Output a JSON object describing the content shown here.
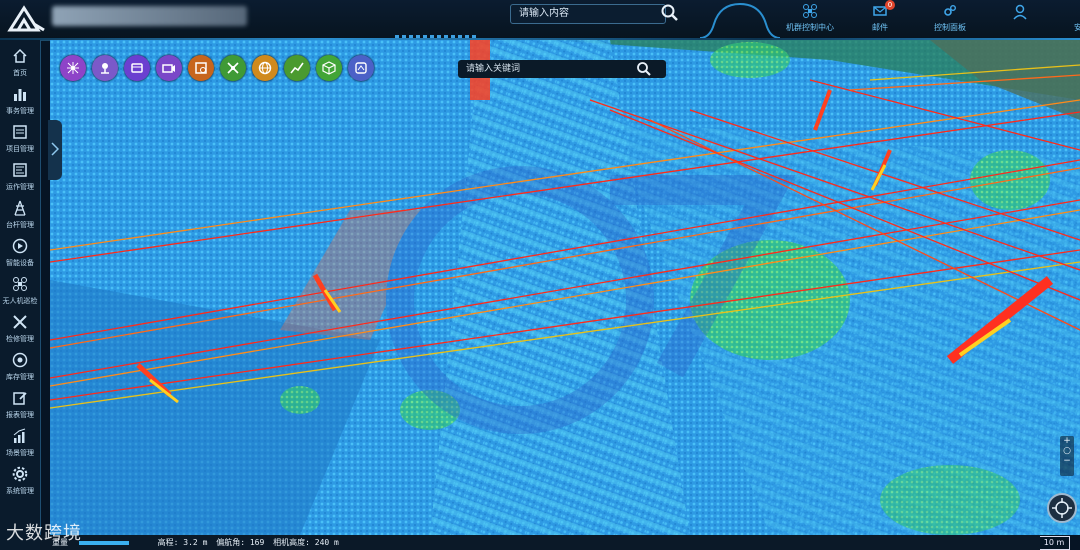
{
  "header": {
    "search_placeholder": "请输入内容",
    "nav": [
      {
        "label": "机群控制中心",
        "icon": "drone-icon"
      },
      {
        "label": "邮件",
        "icon": "mail-icon",
        "badge": "0"
      },
      {
        "label": "控制面板",
        "icon": "gears-icon"
      },
      {
        "label": "",
        "icon": "user-icon"
      },
      {
        "label": "安全退出",
        "icon": "power-icon"
      }
    ]
  },
  "sidebar": {
    "items": [
      {
        "label": "首页",
        "icon": "home-icon"
      },
      {
        "label": "事务管理",
        "icon": "bar-chart-icon"
      },
      {
        "label": "项目管理",
        "icon": "document-icon"
      },
      {
        "label": "运作管理",
        "icon": "form-icon"
      },
      {
        "label": "台杆管理",
        "icon": "tower-icon"
      },
      {
        "label": "智能设备",
        "icon": "play-icon"
      },
      {
        "label": "无人机巡检",
        "icon": "drone-icon"
      },
      {
        "label": "检修管理",
        "icon": "tools-icon"
      },
      {
        "label": "库存管理",
        "icon": "target-icon"
      },
      {
        "label": "报表管理",
        "icon": "edit-icon"
      },
      {
        "label": "场景管理",
        "icon": "stats-icon"
      },
      {
        "label": "系统管理",
        "icon": "settings-icon"
      }
    ]
  },
  "map": {
    "search_placeholder": "请输入关键词",
    "tools": [
      {
        "icon": "network-icon",
        "color": "#8e44c8"
      },
      {
        "icon": "pin-icon",
        "color": "#7b59c9"
      },
      {
        "icon": "layers-icon",
        "color": "#6b3fd0"
      },
      {
        "icon": "camera-icon",
        "color": "#7a47c8"
      },
      {
        "icon": "analysis-icon",
        "color": "#c7651d"
      },
      {
        "icon": "route-icon",
        "color": "#3f9a36"
      },
      {
        "icon": "globe-icon",
        "color": "#d08a1d"
      },
      {
        "icon": "line-chart-icon",
        "color": "#4a9a2f"
      },
      {
        "icon": "cube-icon",
        "color": "#42a537"
      },
      {
        "icon": "map-icon",
        "color": "#4b61c7"
      }
    ],
    "scale": "10 m",
    "zoom_in": "+",
    "zoom_reset": "○",
    "zoom_out": "−"
  },
  "status": {
    "level_label": "重量",
    "height_label": "高程",
    "height_value": "3.2 m",
    "heading_label": "偏航角",
    "heading_value": "169",
    "camera_label": "相机高度",
    "camera_value": "240 m"
  },
  "watermark": "大数跨境",
  "colors": {
    "accent": "#2a8fd0",
    "powerline": "#ff2a1a",
    "cloud_blue": "#35a8f0",
    "cloud_green": "#37e07a"
  }
}
